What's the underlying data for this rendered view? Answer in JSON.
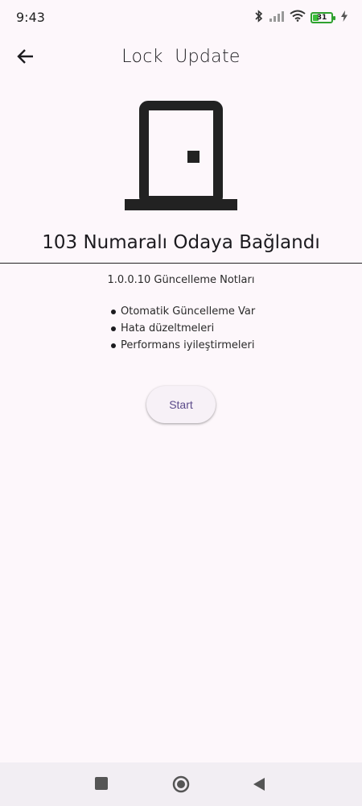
{
  "status_bar": {
    "time": "9:43",
    "battery_level": "31",
    "icons": [
      "bluetooth-icon",
      "signal-icon",
      "wifi-icon",
      "battery-icon",
      "charging-icon"
    ]
  },
  "app_bar": {
    "title": "Lock  Update",
    "back_icon": "arrow-left-icon"
  },
  "main": {
    "icon": "door-icon",
    "room_title": "103 Numaralı Odaya Bağlandı",
    "notes_title": "1.0.0.10 Güncelleme Notları",
    "notes": [
      "Otomatik Güncelleme Var",
      "Hata düzeltmeleri",
      "Performans iyileştirmeleri"
    ],
    "start_label": "Start"
  },
  "colors": {
    "background": "#fdf7fb",
    "accent": "#5b4a8a",
    "battery": "#3bbf3b"
  }
}
